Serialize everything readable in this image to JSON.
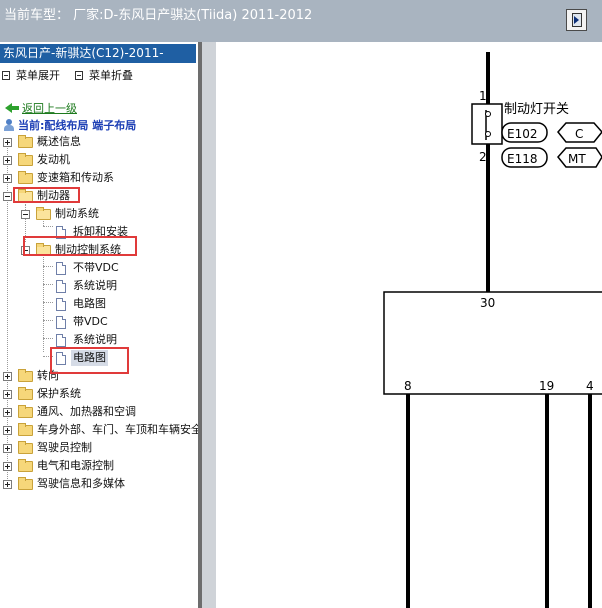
{
  "window": {
    "title": "当前车型：  厂家:D-东风日产骐达(Tiida) 2011-2012",
    "exit_icon": "exit-door-icon"
  },
  "left_panel": {
    "vehicle_header": "东风日产-新骐达(C12)-2011-",
    "toolbar": {
      "expand_label": "菜单展开",
      "collapse_label": "菜单折叠"
    },
    "back_label": "返回上一级",
    "current_label": "当前:配线布局 端子布局",
    "tree": {
      "overview": "概述信息",
      "engine": "发动机",
      "transmission": "变速箱和传动系",
      "brakes": "制动器",
      "brake_system": "制动系统",
      "removal_install": "拆卸和安装",
      "brake_control_system": "制动控制系统",
      "no_vdc": "不带VDC",
      "system_desc_1": "系统说明",
      "circuit_diagram_1": "电路图",
      "with_vdc": "带VDC",
      "system_desc_2": "系统说明",
      "circuit_diagram_2": "电路图",
      "steering": "转向",
      "protection": "保护系统",
      "hvac": "通风、加热器和空调",
      "body": "车身外部、车门、车顶和车辆安全",
      "driver_controls": "驾驶员控制",
      "electrical": "电气和电源控制",
      "info_multimedia": "驾驶信息和多媒体"
    }
  },
  "diagram": {
    "switch_pin_top": "1",
    "switch_pin_bottom": "2",
    "switch_name": "制动灯开关",
    "connector_1": "E102",
    "connector_1_tag": "C",
    "connector_2": "E118",
    "connector_2_tag": "MT",
    "module_pin_top": "30",
    "module_pin_1": "8",
    "module_pin_2": "19",
    "module_pin_3": "4"
  },
  "colors": {
    "titlebar": "#a9b4c0",
    "header": "#1f5fa3",
    "highlight_box": "#e03a3a",
    "current_text": "#1d3fb5",
    "back_link": "#1d7a1d"
  }
}
